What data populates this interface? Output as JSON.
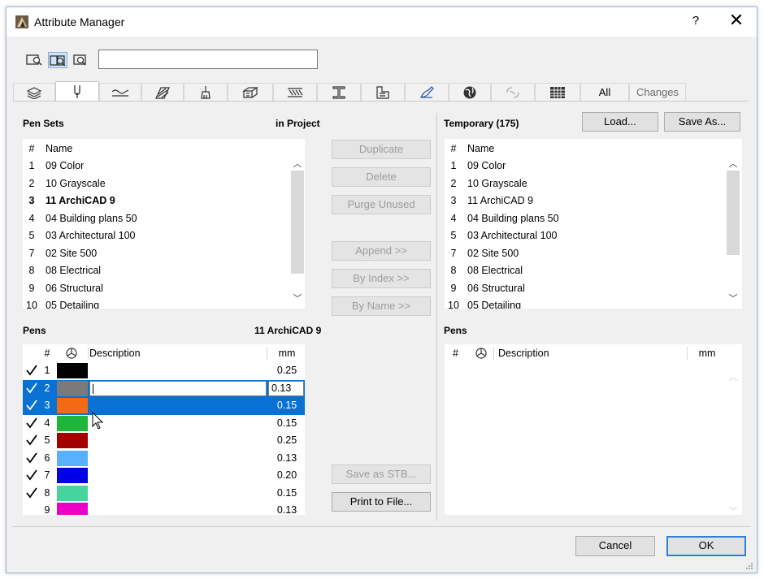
{
  "window": {
    "title": "Attribute Manager",
    "help": "?",
    "close": "✕"
  },
  "search": {
    "value": "",
    "placeholder": ""
  },
  "tabs": {
    "all": "All",
    "changes": "Changes"
  },
  "left": {
    "pen_sets_label": "Pen Sets",
    "source_label": "in Project",
    "list_headers": {
      "num": "#",
      "name": "Name"
    },
    "items": [
      {
        "num": "1",
        "name": "09 Color"
      },
      {
        "num": "2",
        "name": "10 Grayscale"
      },
      {
        "num": "3",
        "name": "11 ArchiCAD 9",
        "bold": true
      },
      {
        "num": "4",
        "name": "04 Building plans 50"
      },
      {
        "num": "5",
        "name": "03 Architectural 100"
      },
      {
        "num": "7",
        "name": "02 Site 500"
      },
      {
        "num": "8",
        "name": "08 Electrical"
      },
      {
        "num": "9",
        "name": "06 Structural"
      },
      {
        "num": "10",
        "name": "05 Detailing"
      }
    ],
    "pens_label": "Pens",
    "pens_set_name": "11 ArchiCAD 9",
    "pens_headers": {
      "num": "#",
      "description": "Description",
      "mm": "mm"
    },
    "pens": [
      {
        "num": "1",
        "color": "#000000",
        "mm": "0.25",
        "checked": true
      },
      {
        "num": "2",
        "color": "#7a7a7a",
        "mm": "0.13",
        "checked": true,
        "editing": true
      },
      {
        "num": "3",
        "color": "#f26a12",
        "mm": "0.15",
        "checked": true,
        "selected": true
      },
      {
        "num": "4",
        "color": "#1fb53a",
        "mm": "0.15",
        "checked": true
      },
      {
        "num": "5",
        "color": "#a40000",
        "mm": "0.25",
        "checked": true
      },
      {
        "num": "6",
        "color": "#59b0ff",
        "mm": "0.13",
        "checked": true
      },
      {
        "num": "7",
        "color": "#0000e6",
        "mm": "0.20",
        "checked": true
      },
      {
        "num": "8",
        "color": "#46d3a0",
        "mm": "0.15",
        "checked": true
      },
      {
        "num": "9",
        "color": "#ec00c8",
        "mm": "0.13",
        "checked": false
      }
    ]
  },
  "middle": {
    "duplicate": "Duplicate",
    "delete": "Delete",
    "purge": "Purge Unused",
    "append": "Append >>",
    "by_index": "By Index >>",
    "by_name": "By Name >>",
    "save_stb": "Save as STB...",
    "print": "Print to File..."
  },
  "right": {
    "temp_label": "Temporary (175)",
    "load": "Load...",
    "save_as": "Save As...",
    "list_headers": {
      "num": "#",
      "name": "Name"
    },
    "items": [
      {
        "num": "1",
        "name": "09 Color"
      },
      {
        "num": "2",
        "name": "10 Grayscale"
      },
      {
        "num": "3",
        "name": "11 ArchiCAD 9"
      },
      {
        "num": "4",
        "name": "04 Building plans 50"
      },
      {
        "num": "5",
        "name": "03 Architectural 100"
      },
      {
        "num": "7",
        "name": "02 Site 500"
      },
      {
        "num": "8",
        "name": "08 Electrical"
      },
      {
        "num": "9",
        "name": "06 Structural"
      },
      {
        "num": "10",
        "name": "05 Detailing"
      }
    ],
    "pens_label": "Pens",
    "pens_headers": {
      "num": "#",
      "description": "Description",
      "mm": "mm"
    }
  },
  "footer": {
    "cancel": "Cancel",
    "ok": "OK"
  }
}
